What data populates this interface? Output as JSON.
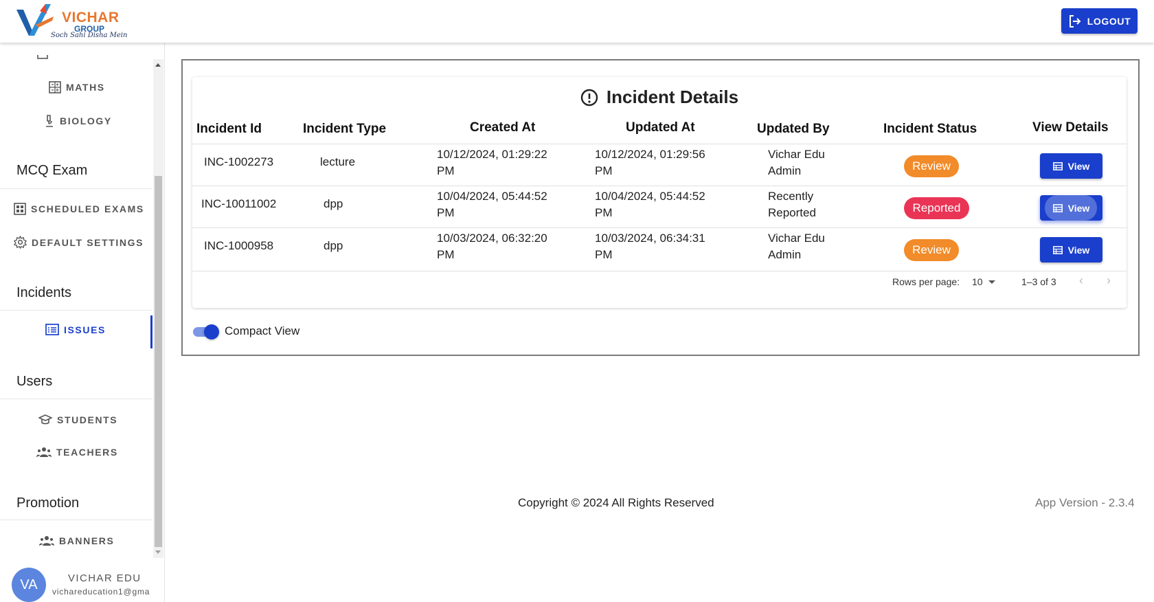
{
  "header": {
    "logo_name": "VICHAR",
    "logo_group": "GROUP",
    "logo_tagline": "Soch Sahi Disha Mein",
    "logout_label": "LOGOUT"
  },
  "sidebar": {
    "subjects": [
      {
        "label": "MATHS",
        "icon": "calculator-icon"
      },
      {
        "label": "BIOLOGY",
        "icon": "microscope-icon"
      }
    ],
    "sections": [
      {
        "title": "MCQ Exam",
        "items": [
          {
            "label": "SCHEDULED EXAMS",
            "icon": "grid-icon"
          },
          {
            "label": "DEFAULT SETTINGS",
            "icon": "gear-icon"
          }
        ]
      },
      {
        "title": "Incidents",
        "items": [
          {
            "label": "ISSUES",
            "icon": "list-icon",
            "active": true
          }
        ]
      },
      {
        "title": "Users",
        "items": [
          {
            "label": "STUDENTS",
            "icon": "graduation-cap-icon"
          },
          {
            "label": "TEACHERS",
            "icon": "group-icon"
          }
        ]
      },
      {
        "title": "Promotion",
        "items": [
          {
            "label": "BANNERS",
            "icon": "group-icon"
          }
        ]
      }
    ],
    "user": {
      "initials": "VA",
      "name": "VICHAR EDU",
      "email": "vichareducation1@gma"
    }
  },
  "main": {
    "title": "Incident Details",
    "columns": [
      "Incident Id",
      "Incident Type",
      "Created At",
      "Updated At",
      "Updated By",
      "Incident Status",
      "View Details"
    ],
    "rows": [
      {
        "id": "INC-1002273",
        "type": "lecture",
        "created_l1": "10/12/2024, 01:29:22",
        "created_l2": "PM",
        "updated_l1": "10/12/2024, 01:29:56",
        "updated_l2": "PM",
        "by_l1": "Vichar Edu",
        "by_l2": "Admin",
        "status": "Review",
        "view": "View"
      },
      {
        "id": "INC-10011002",
        "type": "dpp",
        "created_l1": "10/04/2024, 05:44:52",
        "created_l2": "PM",
        "updated_l1": "10/04/2024, 05:44:52",
        "updated_l2": "PM",
        "by_l1": "Recently",
        "by_l2": "Reported",
        "status": "Reported",
        "view": "View"
      },
      {
        "id": "INC-1000958",
        "type": "dpp",
        "created_l1": "10/03/2024, 06:32:20",
        "created_l2": "PM",
        "updated_l1": "10/03/2024, 06:34:31",
        "updated_l2": "PM",
        "by_l1": "Vichar Edu",
        "by_l2": "Admin",
        "status": "Review",
        "view": "View"
      }
    ],
    "pagination": {
      "rows_per_page_label": "Rows per page:",
      "rows_per_page": "10",
      "range": "1–3 of 3"
    },
    "compact_view_label": "Compact View",
    "compact_view_on": true
  },
  "footer": {
    "copyright": "Copyright © 2024 All Rights Reserved",
    "version": "App Version - 2.3.4"
  },
  "colors": {
    "primary": "#1a3fcc",
    "review": "#f28b29",
    "reported": "#ea3456",
    "logo_orange": "#e8772e",
    "logo_blue": "#1f5fa8"
  }
}
